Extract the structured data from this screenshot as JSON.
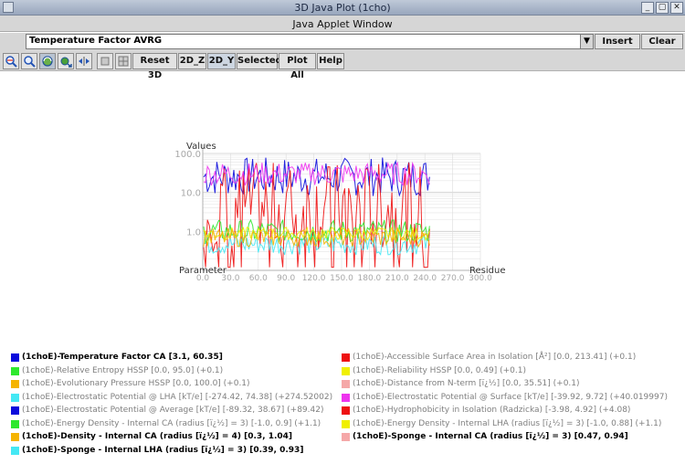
{
  "window": {
    "title": "3D Java Plot (1cho)",
    "subtitle": "Java Applet Window",
    "controls": [
      "_",
      "▢",
      "✕"
    ]
  },
  "property_select": {
    "value": "Temperature Factor AVRG",
    "insert_label": "Insert",
    "clear_label": "Clear"
  },
  "toolbar": {
    "icons": [
      "zoom-reset-icon",
      "zoom-icon",
      "rotate-icon",
      "move-icon",
      "stretch-icon",
      "square-icon",
      "grid-icon"
    ],
    "buttons": [
      "Reset 3D",
      "2D_Z",
      "2D_Y",
      "Selected",
      "Plot All",
      "Help"
    ]
  },
  "chart_data": {
    "type": "line",
    "y_label": "Values",
    "x_label_left": "Parameter",
    "x_label_right": "Residue",
    "x_scale": "linear",
    "y_scale": "log",
    "xlim": [
      0,
      300
    ],
    "ylim": [
      0.1,
      100
    ],
    "x_ticks": [
      "0.0",
      "30.0",
      "60.0",
      "90.0",
      "120.0",
      "150.0",
      "180.0",
      "210.0",
      "240.0",
      "270.0",
      "300.0"
    ],
    "y_ticks": [
      "100.0",
      "10.0",
      "1.0"
    ],
    "grid": true,
    "series": [
      {
        "name": "(1choE)-Temperature Factor CA",
        "color": "#0a0adc",
        "range": [
          3.1,
          60.35
        ],
        "x_extent": [
          1,
          245
        ]
      },
      {
        "name": "(1choE)-Accessible Surface Area in Isolation [Å²]",
        "color": "#ee1111",
        "range": [
          0.0,
          213.41
        ],
        "x_extent": [
          1,
          245
        ]
      },
      {
        "name": "(1choE)-Sponge - Internal LHA (radius [ï¿½] = 3)",
        "color": "#44e8f4",
        "range": [
          0.39,
          0.93
        ],
        "x_extent": [
          1,
          245
        ]
      },
      {
        "name": "(1choE)-Energy Density - Internal CA (radius [ï¿½] = 3)",
        "color": "#2ee82e",
        "range": [
          -1.0,
          0.9
        ],
        "x_extent": [
          1,
          245
        ]
      },
      {
        "name": "(1choE)-Electrostatic Potential @ Surface [kT/e]",
        "color": "#ee33ee",
        "range": [
          -39.92,
          9.72
        ],
        "x_extent": [
          1,
          245
        ]
      },
      {
        "name": "(1choE)-Reliability HSSP",
        "color": "#f0f000",
        "range": [
          0.0,
          0.49
        ],
        "x_extent": [
          1,
          245
        ]
      },
      {
        "name": "(1choE)-Density - Internal CA (radius [ï¿½] = 4)",
        "color": "#f5b400",
        "range": [
          0.3,
          1.04
        ],
        "x_extent": [
          1,
          245
        ]
      }
    ]
  },
  "legend": {
    "left": [
      {
        "text": "(1choE)-Temperature Factor CA  [3.1, 60.35]",
        "color": "#0a0adc",
        "style": "bold"
      },
      {
        "text": "(1choE)-Relative Entropy HSSP  [0.0, 95.0] (+0.1)",
        "color": "#2ee82e",
        "style": "dim"
      },
      {
        "text": "(1choE)-Evolutionary Pressure HSSP  [0.0, 100.0] (+0.1)",
        "color": "#f5b400",
        "style": "dim"
      },
      {
        "text": "(1choE)-Electrostatic Potential @ LHA [kT/e]  [-274.42, 74.38] (+274.52002)",
        "color": "#44e8f4",
        "style": "dim"
      },
      {
        "text": "(1choE)-Electrostatic Potential @ Average [kT/e]  [-89.32, 38.67] (+89.42)",
        "color": "#0a0adc",
        "style": "dim"
      },
      {
        "text": "(1choE)-Energy Density - Internal CA (radius [ï¿½] = 3)  [-1.0, 0.9] (+1.1)",
        "color": "#2ee82e",
        "style": "dim"
      },
      {
        "text": "(1choE)-Density - Internal CA (radius [ï¿½] = 4)  [0.3, 1.04]",
        "color": "#f5b400",
        "style": "bold"
      },
      {
        "text": "(1choE)-Sponge - Internal LHA (radius [ï¿½] = 3)  [0.39, 0.93]",
        "color": "#44e8f4",
        "style": "bold"
      }
    ],
    "right": [
      {
        "text": "(1choE)-Accessible Surface Area in Isolation [Å²]  [0.0, 213.41] (+0.1)",
        "color": "#ee1111",
        "style": "dim"
      },
      {
        "text": "(1choE)-Reliability HSSP  [0.0, 0.49] (+0.1)",
        "color": "#f0f000",
        "style": "dim"
      },
      {
        "text": "(1choE)-Distance from N-term [ï¿½]  [0.0, 35.51] (+0.1)",
        "color": "#f5a8a8",
        "style": "dim"
      },
      {
        "text": "(1choE)-Electrostatic Potential @ Surface [kT/e]  [-39.92, 9.72] (+40.019997)",
        "color": "#ee33ee",
        "style": "dim"
      },
      {
        "text": "(1choE)-Hydrophobicity in Isolation (Radzicka)  [-3.98, 4.92] (+4.08)",
        "color": "#ee1111",
        "style": "dim"
      },
      {
        "text": "(1choE)-Energy Density - Internal LHA (radius [ï¿½] = 3)  [-1.0, 0.88] (+1.1)",
        "color": "#f0f000",
        "style": "dim"
      },
      {
        "text": "(1choE)-Sponge - Internal CA (radius [ï¿½] = 3)  [0.47, 0.94]",
        "color": "#f5a8a8",
        "style": "bold"
      }
    ]
  }
}
